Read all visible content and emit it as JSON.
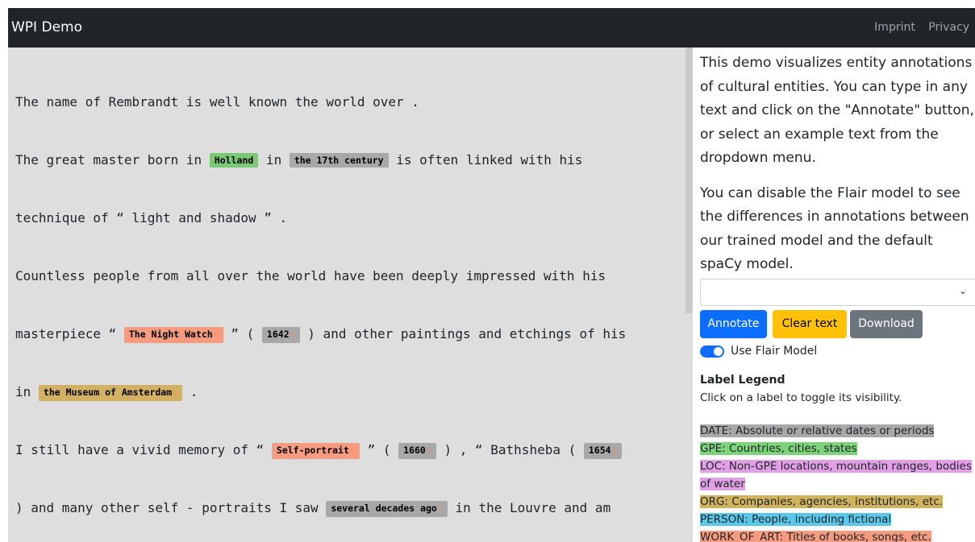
{
  "navbar": {
    "brand": "WPI Demo",
    "links": [
      "Imprint",
      "Privacy"
    ]
  },
  "editor": {
    "lines": [
      [
        {
          "t": "The name of Rembrandt is well known the world over ."
        }
      ],
      [
        {
          "t": "The great master born in "
        },
        {
          "e": "Holland",
          "c": "gpe"
        },
        {
          "t": " in "
        },
        {
          "e": "the 17th century",
          "c": "date"
        },
        {
          "t": " is often linked with his"
        }
      ],
      [
        {
          "t": "technique of “ light and shadow ” ."
        }
      ],
      [
        {
          "t": "Countless people from all over the world have been deeply impressed with his"
        }
      ],
      [
        {
          "t": "masterpiece “ "
        },
        {
          "e": "The Night Watch",
          "c": "woa",
          "pen": true
        },
        {
          "t": " ” ( "
        },
        {
          "e": "1642",
          "c": "date",
          "pen": true
        },
        {
          "t": " ) and other paintings and etchings of his"
        }
      ],
      [
        {
          "t": "in "
        },
        {
          "e": "the Museum of Amsterdam",
          "c": "org",
          "pen": true
        },
        {
          "t": " ."
        }
      ],
      [
        {
          "t": "I still have a vivid memory of “ "
        },
        {
          "e": "Self-portrait",
          "c": "woa",
          "pen": true
        },
        {
          "t": " ” ( "
        },
        {
          "e": "1660",
          "c": "date",
          "pen": true
        },
        {
          "t": " ) , “ Bathsheba ( "
        },
        {
          "e": "1654",
          "c": "date",
          "pen": true
        }
      ],
      [
        {
          "t": ") and many other self - portraits I saw "
        },
        {
          "e": "several decades ago",
          "c": "date",
          "pen": true
        },
        {
          "t": " in the Louvre and am"
        }
      ]
    ]
  },
  "sidebar": {
    "description": "This demo visualizes entity annotations of cultural entities. You can type in any text and click on the \"Annotate\" button, or select an example text from the dropdown menu.",
    "description2": "You can disable the Flair model to see the differences in annotations between our trained model and the default spaCy model.",
    "select_value": "",
    "buttons": {
      "annotate": "Annotate",
      "clear": "Clear text",
      "download": "Download"
    },
    "toggle_label": "Use Flair Model",
    "toggle_on": true,
    "legend_title": "Label Legend",
    "legend_hint": "Click on a label to toggle its visibility.",
    "legend": [
      {
        "label": "DATE: Absolute or relative dates or periods",
        "c": "li-date"
      },
      {
        "label": "GPE: Countries, cities, states",
        "c": "li-gpe"
      },
      {
        "label": "LOC: Non-GPE locations, mountain ranges, bodies of water",
        "c": "li-loc"
      },
      {
        "label": "ORG: Companies, agencies, institutions, etc.",
        "c": "li-org"
      },
      {
        "label": "PERSON: People, including fictional",
        "c": "li-person"
      },
      {
        "label": "WORK_OF_ART: Titles of books, songs, etc.",
        "c": "li-woa"
      }
    ]
  },
  "colors": {
    "navbar": "#212529",
    "primary": "#0d6efd",
    "warning": "#ffc107",
    "secondary": "#6c757d",
    "gpe": "#7ac774",
    "date": "#a8a8a8",
    "work_of_art": "#f59b7f",
    "org": "#d2b064",
    "loc": "#e1a0e6",
    "person": "#5bc8ea"
  },
  "icons": {
    "select_chevron": "chevron-down-icon",
    "entity_edit": "pencil-icon"
  }
}
